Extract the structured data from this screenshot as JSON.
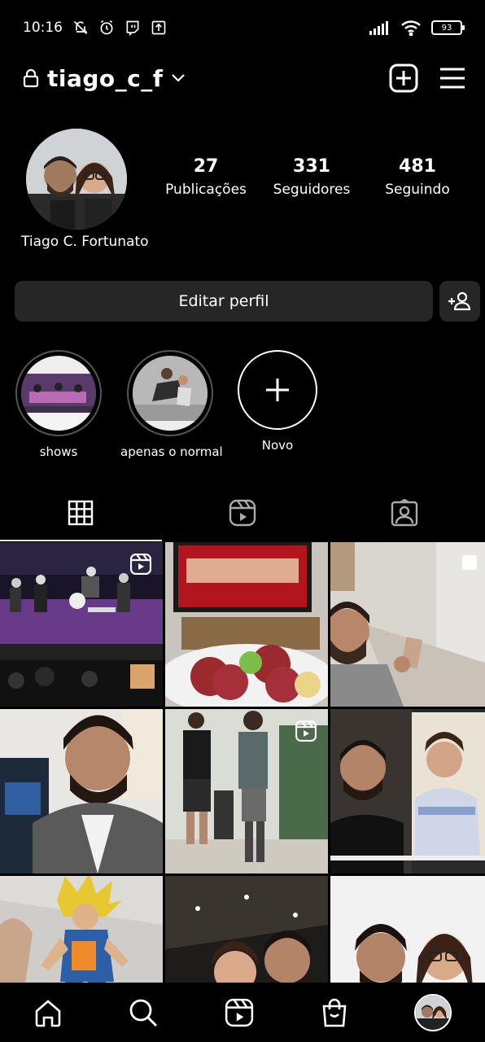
{
  "status_bar": {
    "time": "10:16",
    "battery": "93",
    "icons": [
      "mute-icon",
      "alarm-icon",
      "twitch-icon",
      "upload-icon",
      "signal-icon",
      "wifi-icon",
      "battery-icon"
    ]
  },
  "header": {
    "username": "tiago_c_f",
    "icons": [
      "lock-icon",
      "chevron-down-icon",
      "new-post-icon",
      "menu-icon"
    ]
  },
  "profile": {
    "display_name": "Tiago C. Fortunato",
    "stats": [
      {
        "value": "27",
        "label": "Publicações"
      },
      {
        "value": "331",
        "label": "Seguidores"
      },
      {
        "value": "481",
        "label": "Seguindo"
      }
    ]
  },
  "buttons": {
    "edit_profile": "Editar perfil"
  },
  "highlights": [
    {
      "label": "shows"
    },
    {
      "label": "apenas o normal"
    },
    {
      "label": "Novo"
    }
  ],
  "tabs": [
    "grid-icon",
    "reels-icon",
    "tagged-icon"
  ],
  "grid_posts": [
    {
      "type": "reel"
    },
    {
      "type": "photo"
    },
    {
      "type": "multiple"
    },
    {
      "type": "photo"
    },
    {
      "type": "reel"
    },
    {
      "type": "photo"
    },
    {
      "type": "photo"
    },
    {
      "type": "photo"
    },
    {
      "type": "photo"
    }
  ],
  "bottom_nav": [
    "home-icon",
    "search-icon",
    "reels-icon",
    "shop-icon",
    "profile-avatar"
  ],
  "colors": {
    "background": "#000000",
    "button_bg": "#262626",
    "text": "#ffffff",
    "muted_border": "#555555"
  }
}
